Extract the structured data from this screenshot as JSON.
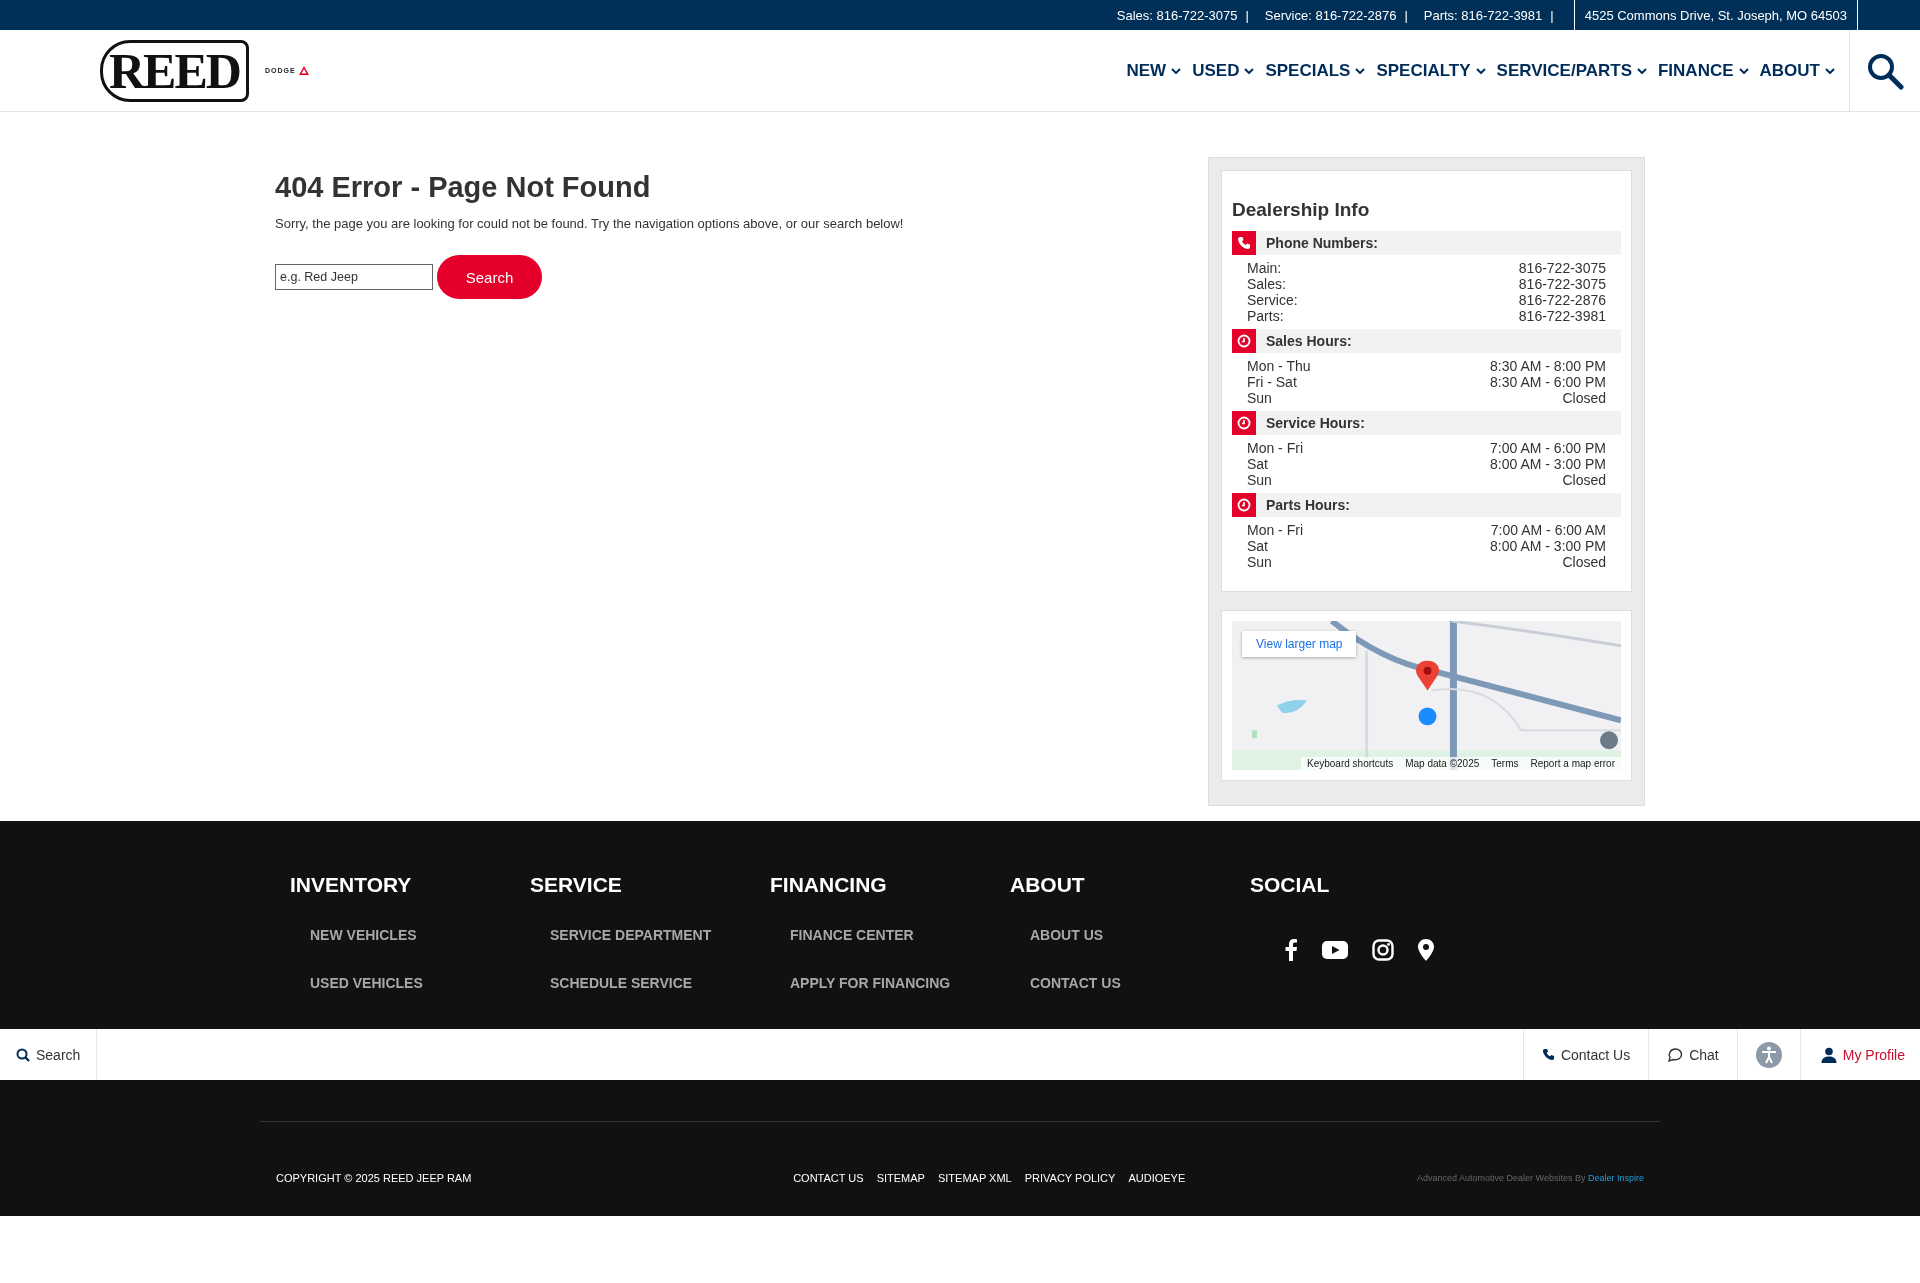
{
  "top_bar": {
    "phones": [
      "Sales: 816-722-3075",
      "Service: 816-722-2876",
      "Parts: 816-722-3981"
    ],
    "separator": "|",
    "address": "4525 Commons Drive, St. Joseph, MO 64503"
  },
  "header": {
    "logo": "REED",
    "brand": "DODGE",
    "nav": [
      {
        "label": "NEW"
      },
      {
        "label": "USED"
      },
      {
        "label": "SPECIALS"
      },
      {
        "label": "SPECIALTY"
      },
      {
        "label": "SERVICE/PARTS"
      },
      {
        "label": "FINANCE"
      },
      {
        "label": "ABOUT"
      }
    ]
  },
  "main": {
    "title": "404 Error - Page Not Found",
    "message": "Sorry, the page you are looking for could not be found. Try the navigation options above, or our search below!",
    "search": {
      "placeholder": "e.g. Red Jeep",
      "button": "Search"
    }
  },
  "dealership_info": {
    "title": "Dealership Info",
    "sections": [
      {
        "kind": "phone",
        "heading": "Phone Numbers:",
        "rows": [
          [
            "Main:",
            "816-722-3075"
          ],
          [
            "Sales:",
            "816-722-3075"
          ],
          [
            "Service:",
            "816-722-2876"
          ],
          [
            "Parts:",
            "816-722-3981"
          ]
        ]
      },
      {
        "kind": "clock",
        "heading": "Sales Hours:",
        "rows": [
          [
            "Mon - Thu",
            "8:30 AM - 8:00 PM"
          ],
          [
            "Fri - Sat",
            "8:30 AM - 6:00 PM"
          ],
          [
            "Sun",
            "Closed"
          ]
        ]
      },
      {
        "kind": "clock",
        "heading": "Service Hours:",
        "rows": [
          [
            "Mon - Fri",
            "7:00 AM - 6:00 PM"
          ],
          [
            "Sat",
            "8:00 AM - 3:00 PM"
          ],
          [
            "Sun",
            "Closed"
          ]
        ]
      },
      {
        "kind": "clock",
        "heading": "Parts Hours:",
        "rows": [
          [
            "Mon - Fri",
            "7:00 AM - 6:00 AM"
          ],
          [
            "Sat",
            "8:00 AM - 3:00 PM"
          ],
          [
            "Sun",
            "Closed"
          ]
        ]
      }
    ]
  },
  "map": {
    "kind": "picture",
    "larger_map": "View larger map",
    "attribution": [
      "Keyboard shortcuts",
      "Map data ©2025",
      "Terms",
      "Report a map error"
    ]
  },
  "footer": {
    "columns": [
      {
        "heading": "INVENTORY",
        "links": [
          "NEW VEHICLES",
          "USED VEHICLES"
        ]
      },
      {
        "heading": "SERVICE",
        "links": [
          "SERVICE DEPARTMENT",
          "SCHEDULE SERVICE"
        ]
      },
      {
        "heading": "FINANCING",
        "links": [
          "FINANCE CENTER",
          "APPLY FOR FINANCING"
        ]
      },
      {
        "heading": "ABOUT",
        "links": [
          "ABOUT US",
          "CONTACT US"
        ]
      }
    ],
    "social": {
      "heading": "SOCIAL",
      "icons": [
        {
          "kind": "facebook"
        },
        {
          "kind": "youtube"
        },
        {
          "kind": "instagram"
        },
        {
          "kind": "location"
        }
      ]
    },
    "copyright": "COPYRIGHT © 2025 REED JEEP RAM",
    "links": [
      "CONTACT US",
      "SITEMAP",
      "SITEMAP XML",
      "PRIVACY POLICY",
      "AUDIOEYE"
    ],
    "credit": "Advanced Automotive Dealer Websites By",
    "credit_link": "Dealer Inspire"
  },
  "sticky_bar": {
    "search": "Search",
    "contact": "Contact Us",
    "chat": "Chat",
    "profile": "My Profile"
  }
}
